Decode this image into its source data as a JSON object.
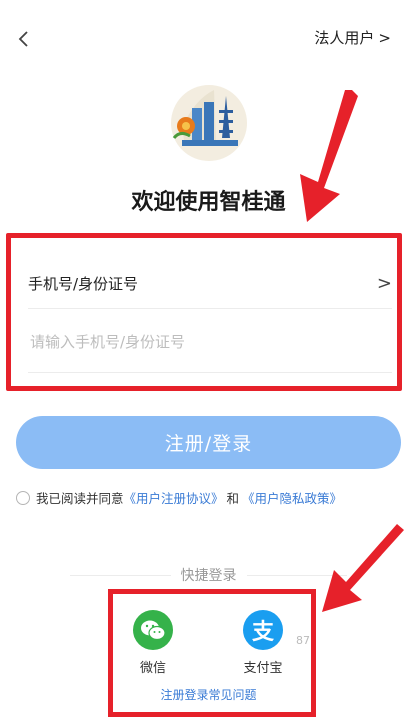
{
  "header": {
    "right_link": "法人用户",
    "right_chevron": ">"
  },
  "app": {
    "title": "欢迎使用智桂通"
  },
  "login_form": {
    "type_selector_label": "手机号/身份证号",
    "type_selector_chevron": ">",
    "input_placeholder": "请输入手机号/身份证号",
    "submit_label": "注册/登录"
  },
  "agreement": {
    "prefix": "我已阅读并同意",
    "user_agreement": "《用户注册协议》",
    "conjunction": "和",
    "privacy_policy": "《用户隐私政策》"
  },
  "quick_login": {
    "title": "快捷登录",
    "options": [
      {
        "label": "微信",
        "icon": "wechat-icon",
        "color": "#35B24A"
      },
      {
        "label": "支付宝",
        "icon": "alipay-icon",
        "glyph": "支",
        "color": "#1A9EF0"
      }
    ],
    "faq_link": "注册登录常见问题",
    "partial_text": "87"
  },
  "colors": {
    "annotation_red": "#E6212A",
    "primary_button": "#8BBCF5",
    "link": "#3A7BD5"
  }
}
